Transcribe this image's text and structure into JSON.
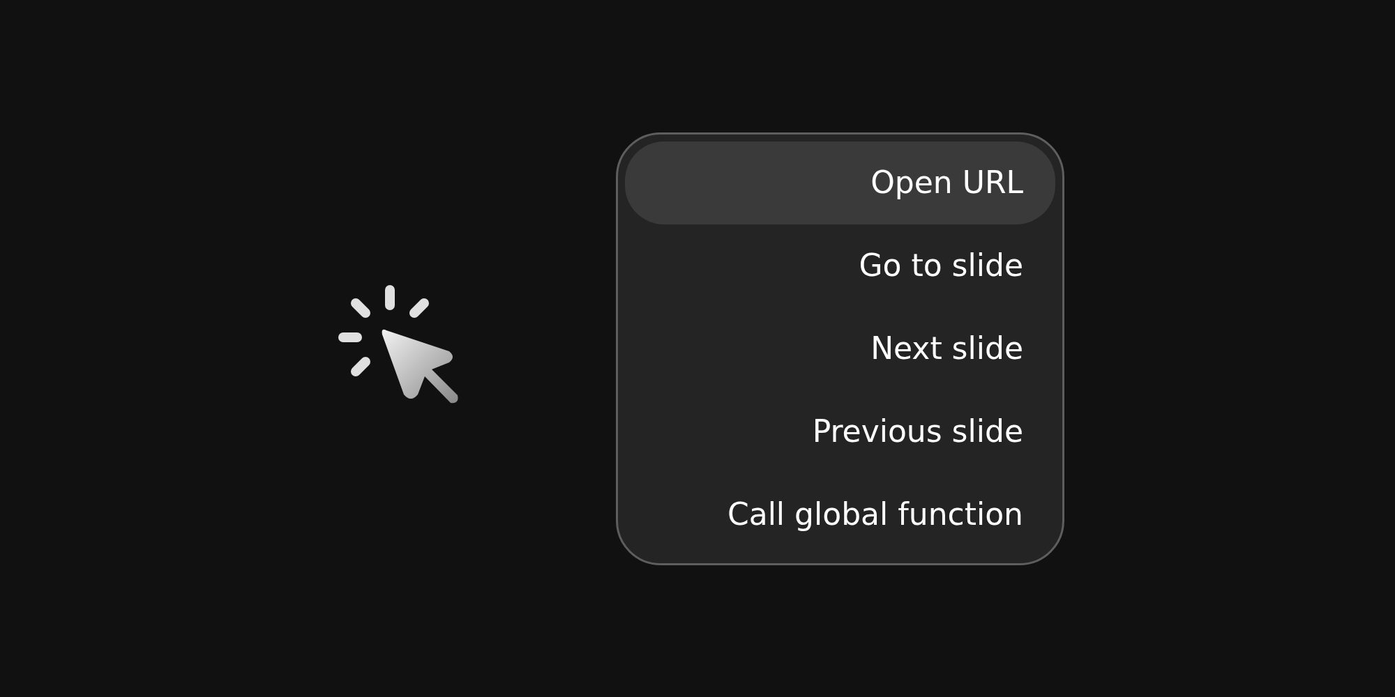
{
  "menu": {
    "items": [
      {
        "label": "Open URL",
        "selected": true
      },
      {
        "label": "Go to slide",
        "selected": false
      },
      {
        "label": "Next slide",
        "selected": false
      },
      {
        "label": "Previous slide",
        "selected": false
      },
      {
        "label": "Call global function",
        "selected": false
      }
    ]
  }
}
